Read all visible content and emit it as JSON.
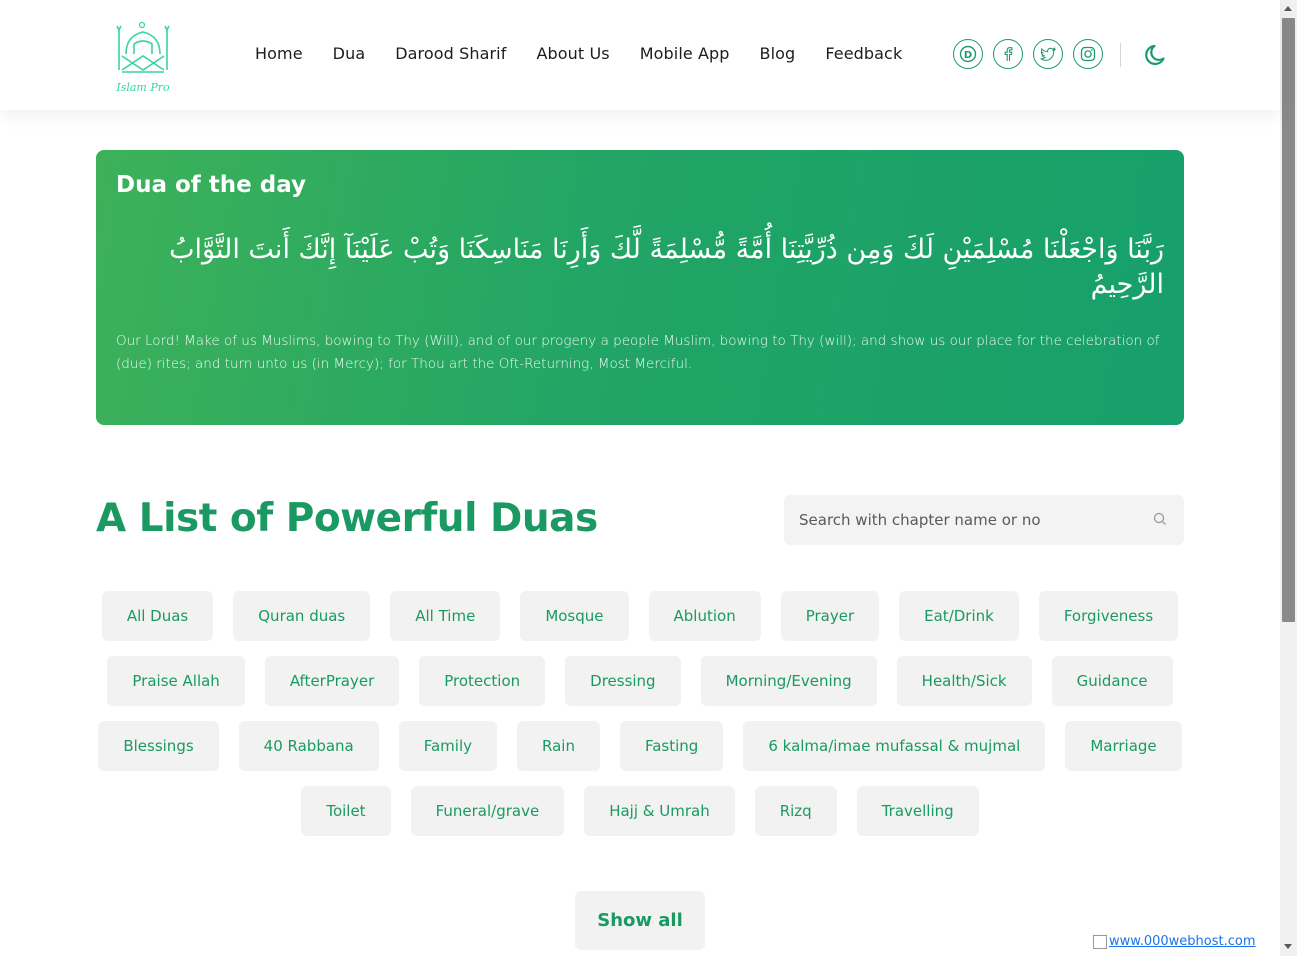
{
  "brand": {
    "logo_text": "Islam Pro"
  },
  "nav": [
    {
      "label": "Home"
    },
    {
      "label": "Dua"
    },
    {
      "label": "Darood Sharif"
    },
    {
      "label": "About Us"
    },
    {
      "label": "Mobile App"
    },
    {
      "label": "Blog"
    },
    {
      "label": "Feedback"
    }
  ],
  "socials": [
    {
      "icon": "dailymotion-icon",
      "glyph": "D"
    },
    {
      "icon": "facebook-icon",
      "glyph": "f"
    },
    {
      "icon": "twitter-icon",
      "glyph": ""
    },
    {
      "icon": "instagram-icon",
      "glyph": ""
    }
  ],
  "theme_toggle_icon": "moon-icon",
  "dua_of_day": {
    "title": "Dua of the day",
    "arabic": "رَبَّنَا وَاجْعَلْنَا مُسْلِمَيْنِ لَكَ وَمِن ذُرِّيَّتِنَا أُمَّةً مُّسْلِمَةً لَّكَ وَأَرِنَا مَنَاسِكَنَا وَتُبْ عَلَيْنَآ إِنَّكَ أَنتَ التَّوَّابُ الرَّحِيمُ",
    "translation": "Our Lord! Make of us Muslims, bowing to Thy (Will), and of our progeny a people Muslim, bowing to Thy (will); and show us our place for the celebration of (due) rites; and turn unto us (in Mercy); for Thou art the Oft-Returning, Most Merciful."
  },
  "list": {
    "title": "A List of Powerful Duas",
    "search_placeholder": "Search with chapter name or no",
    "categories": [
      [
        "All Duas",
        "Quran duas",
        "All Time",
        "Mosque",
        "Ablution",
        "Prayer",
        "Eat/Drink",
        "Forgiveness"
      ],
      [
        "Praise Allah",
        "AfterPrayer",
        "Protection",
        "Dressing",
        "Morning/Evening",
        "Health/Sick",
        "Guidance"
      ],
      [
        "Blessings",
        "40 Rabbana",
        "Family",
        "Rain",
        "Fasting",
        "6 kalma/imae mufassal & mujmal",
        "Marriage"
      ],
      [
        "Toilet",
        "Funeral/grave",
        "Hajj & Umrah",
        "Rizq",
        "Travelling"
      ]
    ],
    "show_all_label": "Show all"
  },
  "footer_badge": {
    "text": "www.000webhost.com"
  },
  "colors": {
    "accent": "#1a9a62",
    "gradient_start": "#3db159",
    "gradient_end": "#17a06b",
    "chip_bg": "#f2f2f2"
  }
}
